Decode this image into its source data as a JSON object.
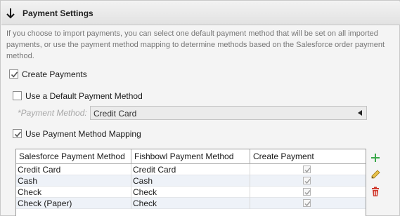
{
  "section": {
    "title": "Payment Settings",
    "description": "If you choose to import payments, you can select one default payment method that will be set on all imported payments, or use the payment method mapping to determine methods based on the Salesforce order payment method."
  },
  "options": {
    "create_payments": {
      "label": "Create Payments",
      "checked": true
    },
    "default_method": {
      "label": "Use a Default Payment Method",
      "checked": false
    },
    "payment_method_label": "*Payment Method:",
    "payment_method_value": "Credit Card",
    "use_mapping": {
      "label": "Use Payment Method Mapping",
      "checked": true
    }
  },
  "mapping_table": {
    "columns": [
      "Salesforce Payment Method",
      "Fishbowl Payment Method",
      "Create Payment"
    ],
    "rows": [
      {
        "salesforce": "Credit Card",
        "fishbowl": "Credit Card",
        "create": true
      },
      {
        "salesforce": "Cash",
        "fishbowl": "Cash",
        "create": true
      },
      {
        "salesforce": "Check",
        "fishbowl": "Check",
        "create": true
      },
      {
        "salesforce": "Check (Paper)",
        "fishbowl": "Check",
        "create": true
      }
    ]
  },
  "icons": {
    "add": "plus-icon",
    "edit": "pencil-icon",
    "delete": "trash-icon"
  },
  "colors": {
    "add": "#3aa84a",
    "edit": "#d4a62a",
    "delete": "#d03a2e"
  }
}
